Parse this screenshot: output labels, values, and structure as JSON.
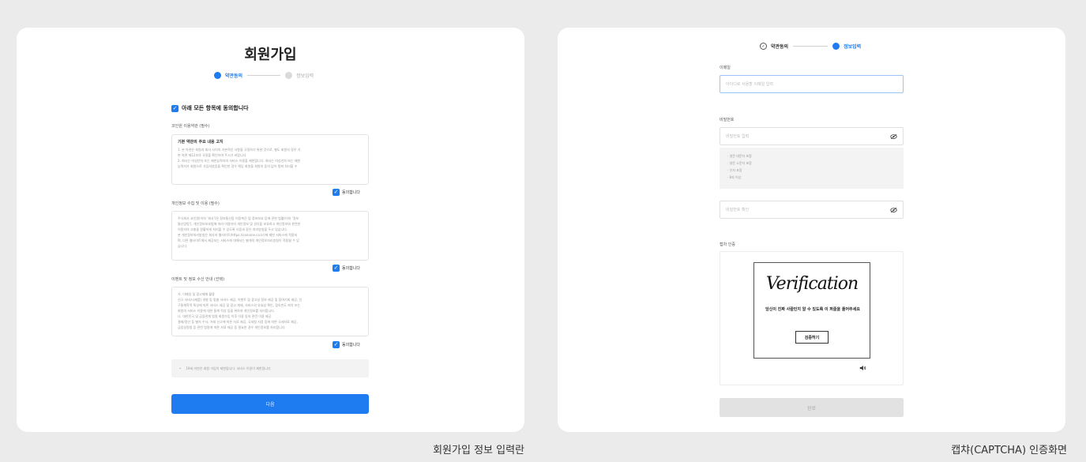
{
  "left_panel": {
    "title": "회원가입",
    "steps": [
      {
        "label": "약관동의",
        "state": "active"
      },
      {
        "label": "정보입력",
        "state": "inactive"
      }
    ],
    "agree_all": "아래 모든 항목에 동의합니다",
    "sections": [
      {
        "title": "코인원 이용약관 (필수)",
        "heading": "기본 약관의 주요 내용 고지",
        "lines": [
          "1. 본 약관은 회원과 회사 사이의 기본적인 사항을 규정하기 위한 것으로, 별도 회원의 경우 기",
          "본 약관 제12조의 규정을 확인하여 주시기 바랍니다.",
          "2. 회사는 미성년자 또는 제한능력자의 서비스 이용을 제한합니다. 회사는 미성년자 또는 제한",
          "능력자가 회원으로 가입하였음을 확인한 경우 해당 회원을 회원의 동의 없이 탈퇴 처리할 수"
        ],
        "agree": "동의합니다"
      },
      {
        "title": "개인정보 수집 및 이용 (필수)",
        "heading": "",
        "lines": [
          "주식회사 코인원(이하 '회사')은 정보통신망 이용촉진 및 정보보호 등에 관한 법률(이하 '정보",
          "통신망법'), 개인정보보호법에 따라 이용자의 개인정보 및 권익을 보호하고 개인정보와 관련한",
          "이용자의 고충을 원활하게 처리할 수 있도록 다음과 같은 처리방침을 두고 있습니다.",
          "본 개인정보처리방침은 회사의 웹사이트(https://coinone.co.kr)에 제반 서비스에 적용되",
          "며, 다른 웹사이트에서 제공되는 서비스에 대해서는 별개의 개인정보처리방침이 적용될 수 있",
          "습니다."
        ],
        "agree": "동의합니다"
      },
      {
        "title": "이벤트 및 정보 수신 안내 (선택)",
        "heading": "",
        "lines": [
          "가. 이메일 및 광고매체 활용",
          "신규 서비스(제품) 개발 및 맞춤 서비스 제공, 이벤트 및 광고성 정보 제공 및 참여기회 제공, 인",
          "구통계학적 특성에 따른 서비스 제공 및 광고 게재, 서비스의 유효성 확인, 접속빈도 파악 또는",
          "회원의 서비스 이용에 대한 통계 작성 등을 위하여 개인정보를 처리합니다.",
          "나. 대한민국 및 금융관계 법령 회원가입 이후 이용 동의 관련 이용 제공",
          "결제/정산 등 별지 수사, 거래 신고에 따른 자료 제공, 국세청 지정 등에 따른 국세자료 제공,",
          "금융실명법 등 관련 법령에 따른 자료 제공 등 필요한 경우 개인정보를 처리합니다."
        ],
        "agree": "동의합니다"
      }
    ],
    "notice": "19세 미만은 회원 가입이 제한됩니다. 서비스 이용이 제한됩니다",
    "next_label": "다음"
  },
  "right_panel": {
    "steps": [
      {
        "label": "약관동의",
        "state": "done"
      },
      {
        "label": "정보입력",
        "state": "active"
      }
    ],
    "email": {
      "label": "이메일",
      "placeholder": "아이디로 사용할 이메일 입력"
    },
    "password": {
      "label": "비밀번호",
      "placeholder": "비밀번호 입력"
    },
    "password_rules": [
      "영문 대문자 포함",
      "영문 소문자 포함",
      "숫자 포함",
      "8자 이상"
    ],
    "password_confirm": {
      "placeholder": "비밀번호 확인"
    },
    "captcha": {
      "label": "캡차 인증",
      "word": "Verification",
      "message": "당신이 진짜 사람인지 알 수 있도록 이 퍼즐을 풀어주세요",
      "verify_label": "검증하기"
    },
    "confirm_label": "완료"
  },
  "captions": {
    "left": "회원가입 정보 입력란",
    "right": "캡챠(CAPTCHA) 인증화면"
  },
  "colors": {
    "accent": "#1f7cf0",
    "background": "#ebebeb",
    "panel": "#ffffff",
    "disabled": "#e2e2e2"
  }
}
